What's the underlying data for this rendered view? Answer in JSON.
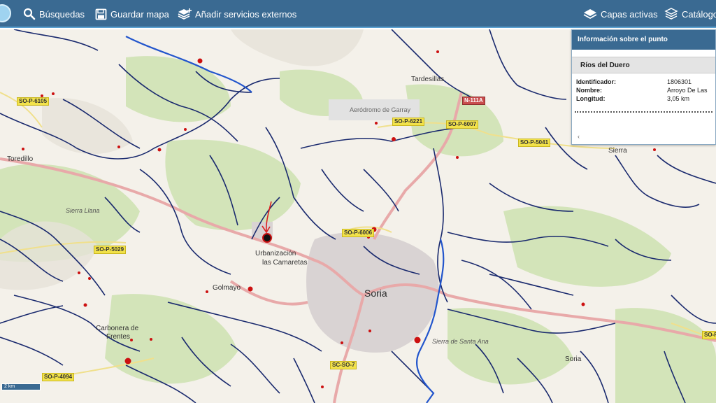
{
  "toolbar": {
    "search_label": "Búsquedas",
    "save_label": "Guardar mapa",
    "add_services_label": "Añadir servicios externos",
    "layers_label": "Capas activas",
    "catalog_label": "Catálogo"
  },
  "map": {
    "labels": {
      "tardesillas": "Tardesillas",
      "aerodromo": "Aeródromo de Garray",
      "toredillo": "Toredillo",
      "sierra_llana": "Sierra Llana",
      "urbanizacion": "Urbanización",
      "las_camaretas": "las Camaretas",
      "golmayo": "Golmayo",
      "soria_city": "Soria",
      "carbonera": "Carbonera de",
      "frentes": "Frentes",
      "sierra_santa_ana": "Sierra de Santa Ana",
      "soria_region": "Soria",
      "sierra_right": "Sierra"
    },
    "roads": {
      "sop6105": "SO-P-6105",
      "sop6221": "SO-P-6221",
      "sop6007": "SO-P-6007",
      "n111a": "N-111A",
      "sop5041": "SO-P-5041",
      "sop5029": "SO-P-5029",
      "sop6006": "SO-P-6006",
      "scso7": "SC-SO-7",
      "sop4094": "SO-P-4094",
      "so_p_right": "SO-P"
    },
    "scale_label": "2 km"
  },
  "info_panel": {
    "title": "Información sobre el punto",
    "layer_name": "Ríos del Duero",
    "fields": [
      {
        "key": "Identificador:",
        "value": "1806301"
      },
      {
        "key": "Nombre:",
        "value": "Arroyo De Las"
      },
      {
        "key": "Longitud:",
        "value": "3,05 km"
      }
    ],
    "scroll_glyph": "‹"
  },
  "colors": {
    "toolbar_bg": "#3a6a92",
    "river": "#1a2a6e",
    "river_main": "#2255cc",
    "road_pink": "#e8a6a6",
    "urban": "#d8d2d0",
    "forest": "#cfe2b4",
    "marker": "#cc1010"
  }
}
